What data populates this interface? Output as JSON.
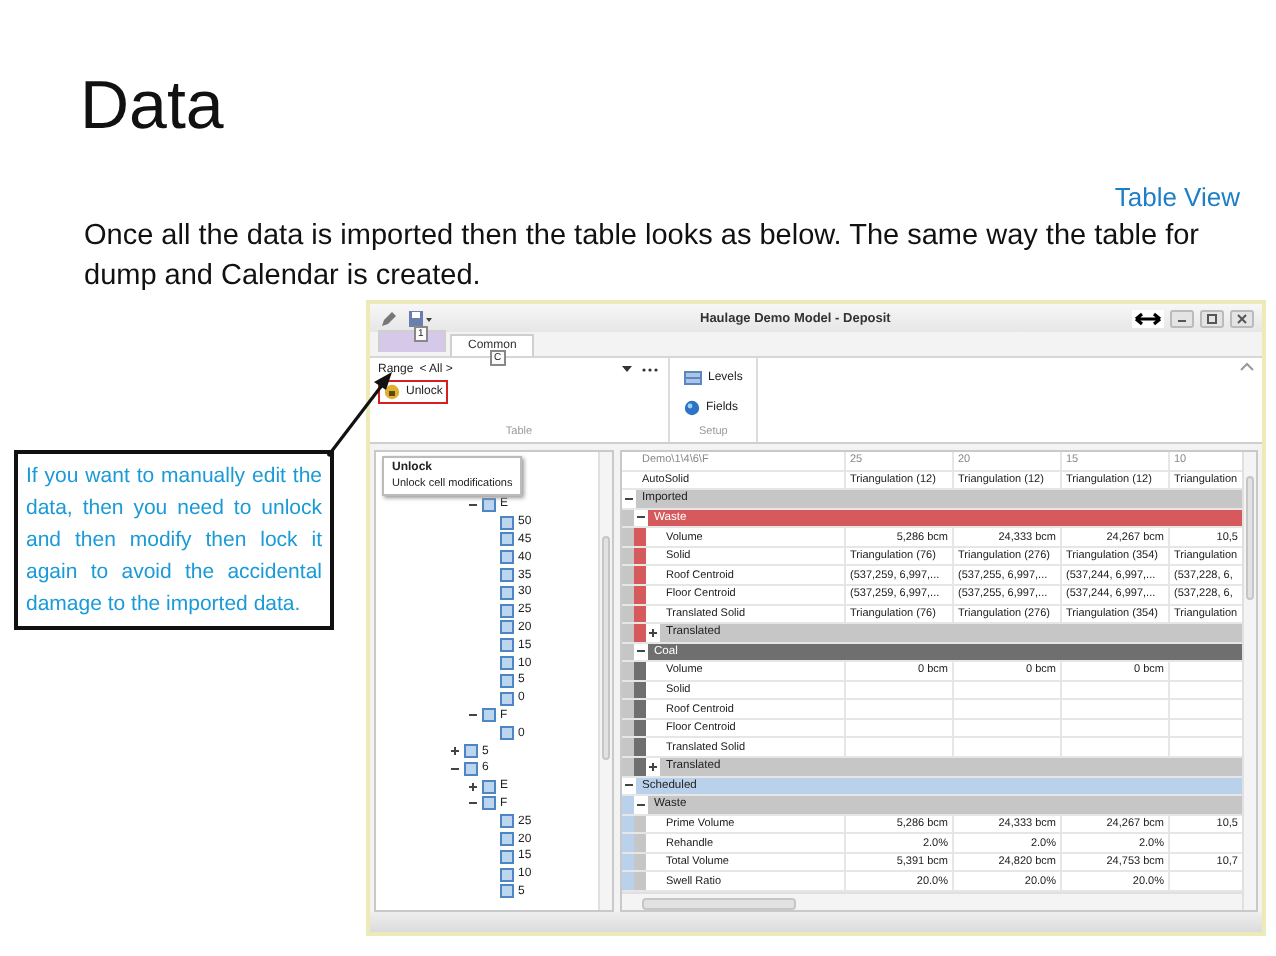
{
  "slide": {
    "title": "Data",
    "section_label": "Table View",
    "intro": "Once all the data is imported then the table looks as below. The same way the table for dump and Calendar is created.",
    "callout": "If you want to manually edit the data, then you need to unlock and then modify then lock it again to avoid the accidental damage to the imported data."
  },
  "window": {
    "title": "Haulage Demo Model - Deposit",
    "keytip": "1"
  },
  "tabs": [
    {
      "selected": false
    },
    {
      "label": "Common",
      "selected": true,
      "keytip": "C"
    }
  ],
  "ribbon": {
    "range_label": "Range",
    "range_value": "< All >",
    "groups": [
      {
        "label": "Table",
        "buttons": [
          {
            "label": "Unlock",
            "highlighted": true
          }
        ]
      },
      {
        "label": "Setup",
        "buttons": [
          {
            "label": "Levels",
            "highlighted": false
          },
          {
            "label": "Fields",
            "highlighted": false
          }
        ]
      }
    ]
  },
  "tooltip": {
    "title": "Unlock",
    "text": "Unlock cell modifications"
  },
  "tree": [
    {
      "children": [
        {
          "label": "E",
          "expanded": true,
          "children": [
            {
              "label": "50"
            },
            {
              "label": "45"
            },
            {
              "label": "40"
            },
            {
              "label": "35"
            },
            {
              "label": "30"
            },
            {
              "label": "25"
            },
            {
              "label": "20"
            },
            {
              "label": "15"
            },
            {
              "label": "10"
            },
            {
              "label": "5"
            },
            {
              "label": "0"
            }
          ]
        },
        {
          "label": "F",
          "expanded": true,
          "children": [
            {
              "label": "0"
            }
          ]
        }
      ]
    },
    {
      "label": "5",
      "expanded": false
    },
    {
      "label": "6",
      "expanded": true,
      "children": [
        {
          "label": "E",
          "expanded": false
        },
        {
          "label": "F",
          "expanded": true,
          "children": [
            {
              "label": "25"
            },
            {
              "label": "20"
            },
            {
              "label": "15"
            },
            {
              "label": "10"
            },
            {
              "label": "5"
            }
          ]
        }
      ]
    }
  ],
  "grid": {
    "columns": [
      "Demo\\1\\4\\6\\F",
      "25",
      "20",
      "15",
      "10"
    ],
    "rows": [
      {
        "kind": "text",
        "label": "AutoSolid",
        "cells": [
          "Triangulation (12)",
          "Triangulation (12)",
          "Triangulation (12)",
          "Triangulation"
        ]
      },
      {
        "kind": "group",
        "label": "Imported",
        "color": "#c6c6c6",
        "expanded": true,
        "children": [
          {
            "kind": "group",
            "label": "Waste",
            "color": "#d65a5c",
            "expanded": true,
            "children": [
              {
                "kind": "number",
                "label": "Volume",
                "cells": [
                  "5,286 bcm",
                  "24,333 bcm",
                  "24,267 bcm",
                  "10,5"
                ]
              },
              {
                "kind": "text",
                "label": "Solid",
                "cells": [
                  "Triangulation (76)",
                  "Triangulation (276)",
                  "Triangulation (354)",
                  "Triangulation"
                ]
              },
              {
                "kind": "text",
                "label": "Roof Centroid",
                "cells": [
                  "(537,259, 6,997,...",
                  "(537,255, 6,997,...",
                  "(537,244, 6,997,...",
                  "(537,228, 6,"
                ]
              },
              {
                "kind": "text",
                "label": "Floor Centroid",
                "cells": [
                  "(537,259, 6,997,...",
                  "(537,255, 6,997,...",
                  "(537,244, 6,997,...",
                  "(537,228, 6,"
                ]
              },
              {
                "kind": "text",
                "label": "Translated Solid",
                "cells": [
                  "Triangulation (76)",
                  "Triangulation (276)",
                  "Triangulation (354)",
                  "Triangulation"
                ]
              },
              {
                "kind": "group",
                "label": "Translated",
                "color": "#c6c6c6",
                "expanded": false
              }
            ]
          },
          {
            "kind": "group",
            "label": "Coal",
            "color": "#6f6f6f",
            "expanded": true,
            "children": [
              {
                "kind": "number",
                "label": "Volume",
                "cells": [
                  "0 bcm",
                  "0 bcm",
                  "0 bcm"
                ]
              },
              {
                "kind": "text",
                "label": "Solid"
              },
              {
                "kind": "text",
                "label": "Roof Centroid"
              },
              {
                "kind": "text",
                "label": "Floor Centroid"
              },
              {
                "kind": "text",
                "label": "Translated Solid"
              },
              {
                "kind": "group",
                "label": "Translated",
                "color": "#c6c6c6",
                "expanded": false
              }
            ]
          }
        ]
      },
      {
        "kind": "group",
        "label": "Scheduled",
        "color": "#b9d1ea",
        "expanded": true,
        "children": [
          {
            "kind": "group",
            "label": "Waste",
            "color": "#c6c6c6",
            "expanded": true,
            "children": [
              {
                "kind": "number",
                "label": "Prime Volume",
                "cells": [
                  "5,286 bcm",
                  "24,333 bcm",
                  "24,267 bcm",
                  "10,5"
                ]
              },
              {
                "kind": "number",
                "label": "Rehandle",
                "cells": [
                  "2.0%",
                  "2.0%",
                  "2.0%"
                ]
              },
              {
                "kind": "number",
                "label": "Total Volume",
                "cells": [
                  "5,391 bcm",
                  "24,820 bcm",
                  "24,753 bcm",
                  "10,7"
                ]
              },
              {
                "kind": "number",
                "label": "Swell Ratio",
                "cells": [
                  "20.0%",
                  "20.0%",
                  "20.0%"
                ]
              }
            ]
          }
        ]
      }
    ]
  }
}
